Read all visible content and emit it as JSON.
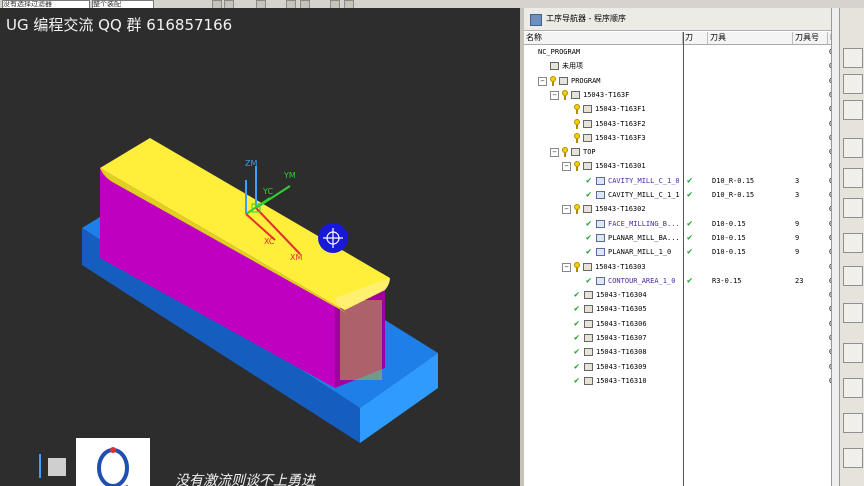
{
  "toolbar": {
    "select1": "没有选择过滤器",
    "select2": "整个装配"
  },
  "viewport": {
    "watermark": "UG 编程交流 QQ 群 616857166",
    "motto": "没有激流则谈不上勇进",
    "axis": {
      "zm": "ZM",
      "ym": "YM",
      "yc": "YC",
      "xc": "XC",
      "xm": "XM"
    }
  },
  "navigator": {
    "title": "工序导航器 - 程序顺序",
    "columns": {
      "name": "名称",
      "tool_check": "刀",
      "tool": "刀具",
      "tool_no": "刀具号",
      "last": "I"
    },
    "rows": [
      {
        "name": "NC_PROGRAM",
        "level": 0,
        "check": false,
        "pin": false,
        "icon": "none",
        "exp": ""
      },
      {
        "name": "未用项",
        "level": 1,
        "check": false,
        "pin": false,
        "icon": "folder",
        "exp": ""
      },
      {
        "name": "PROGRAM",
        "level": 1,
        "check": false,
        "pin": true,
        "icon": "folder",
        "exp": "−"
      },
      {
        "name": "15043-T163F",
        "level": 2,
        "check": false,
        "pin": true,
        "icon": "folder",
        "exp": "−"
      },
      {
        "name": "15043-T163F1",
        "level": 3,
        "check": false,
        "pin": true,
        "icon": "folder",
        "exp": ""
      },
      {
        "name": "15043-T163F2",
        "level": 3,
        "check": false,
        "pin": true,
        "icon": "folder",
        "exp": ""
      },
      {
        "name": "15043-T163F3",
        "level": 3,
        "check": false,
        "pin": true,
        "icon": "folder",
        "exp": ""
      },
      {
        "name": "TOP",
        "level": 2,
        "check": false,
        "pin": true,
        "icon": "folder",
        "exp": "−"
      },
      {
        "name": "15043-T16301",
        "level": 3,
        "check": false,
        "pin": true,
        "icon": "folder",
        "exp": "−"
      },
      {
        "name": "CAVITY_MILL_C_1_0",
        "level": 4,
        "check": true,
        "pin": false,
        "icon": "op",
        "purple": true,
        "tcheck": "✔",
        "tool": "D10_R-0.15",
        "toolno": "3"
      },
      {
        "name": "CAVITY_MILL_C_1_1",
        "level": 4,
        "check": true,
        "pin": false,
        "icon": "op",
        "purple": false,
        "tcheck": "✔",
        "tool": "D10_R-0.15",
        "toolno": "3"
      },
      {
        "name": "15043-T16302",
        "level": 3,
        "check": false,
        "pin": true,
        "icon": "folder",
        "exp": "−"
      },
      {
        "name": "FACE_MILLING_B...",
        "level": 4,
        "check": true,
        "pin": false,
        "icon": "op",
        "purple": true,
        "tcheck": "✔",
        "tool": "D10-0.15",
        "toolno": "9"
      },
      {
        "name": "PLANAR_MILL_BA...",
        "level": 4,
        "check": true,
        "pin": false,
        "icon": "op",
        "purple": false,
        "tcheck": "✔",
        "tool": "D10-0.15",
        "toolno": "9"
      },
      {
        "name": "PLANAR_MILL_1_0",
        "level": 4,
        "check": true,
        "pin": false,
        "icon": "op",
        "purple": false,
        "tcheck": "✔",
        "tool": "D10-0.15",
        "toolno": "9"
      },
      {
        "name": "15043-T16303",
        "level": 3,
        "check": false,
        "pin": true,
        "icon": "folder",
        "exp": "−"
      },
      {
        "name": "CONTOUR_AREA_1_0",
        "level": 4,
        "check": true,
        "pin": false,
        "icon": "op",
        "purple": true,
        "tcheck": "✔",
        "tool": "R3-0.15",
        "toolno": "23"
      },
      {
        "name": "15043-T16304",
        "level": 3,
        "check": true,
        "pin": false,
        "icon": "folder",
        "exp": ""
      },
      {
        "name": "15043-T16305",
        "level": 3,
        "check": true,
        "pin": false,
        "icon": "folder",
        "exp": ""
      },
      {
        "name": "15043-T16306",
        "level": 3,
        "check": true,
        "pin": false,
        "icon": "folder",
        "exp": ""
      },
      {
        "name": "15043-T16307",
        "level": 3,
        "check": true,
        "pin": false,
        "icon": "folder",
        "exp": ""
      },
      {
        "name": "15043-T16308",
        "level": 3,
        "check": true,
        "pin": false,
        "icon": "folder",
        "exp": ""
      },
      {
        "name": "15043-T16309",
        "level": 3,
        "check": true,
        "pin": false,
        "icon": "folder",
        "exp": ""
      },
      {
        "name": "15043-T16310",
        "level": 3,
        "check": true,
        "pin": false,
        "icon": "folder",
        "exp": ""
      }
    ]
  },
  "colors": {
    "yellow_face": "#ffef40",
    "magenta": "#c400c4",
    "base_blue": "#1e90ff",
    "check_green": "#22a02c"
  }
}
